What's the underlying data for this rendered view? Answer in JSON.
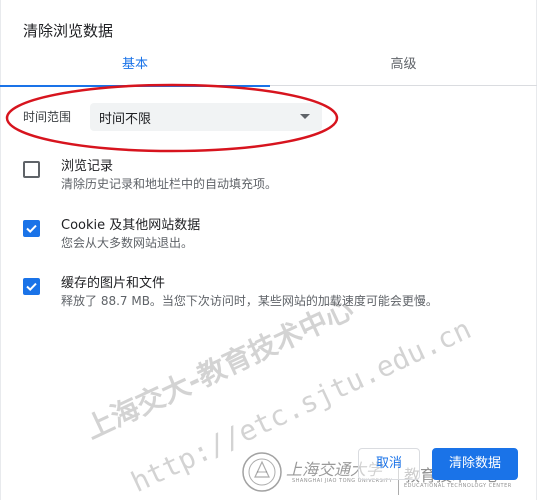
{
  "dialog": {
    "title": "清除浏览数据"
  },
  "tabs": [
    {
      "label": "基本",
      "active": true
    },
    {
      "label": "高级",
      "active": false
    }
  ],
  "time_range": {
    "label": "时间范围",
    "selected": "时间不限"
  },
  "items": [
    {
      "title": "浏览记录",
      "description": "清除历史记录和地址栏中的自动填充项。",
      "checked": false
    },
    {
      "title": "Cookie 及其他网站数据",
      "description": "您会从大多数网站退出。",
      "checked": true
    },
    {
      "title": "缓存的图片和文件",
      "description": "释放了 88.7 MB。当您下次访问时，某些网站的加载速度可能会更慢。",
      "checked": true
    }
  ],
  "buttons": {
    "cancel": "取消",
    "clear": "清除数据"
  },
  "watermark": {
    "chinese": "上海交大-教育技术中心",
    "url": "http://etc.sjtu.edu.cn",
    "signature": "上海交通大学",
    "signature_sub": "SHANGHAI JIAO TONG UNIVERSITY",
    "center": "教育技术中心",
    "center_sub": "EDUCATIONAL TECHNOLOGY CENTER"
  },
  "colors": {
    "accent": "#1a73e8",
    "annotation": "#d7141e",
    "text": "#202124",
    "secondary_text": "#5f6368"
  }
}
